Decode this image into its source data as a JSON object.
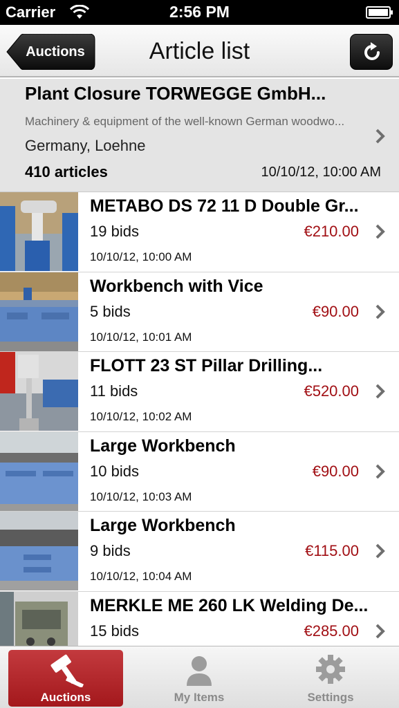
{
  "status_bar": {
    "carrier": "Carrier",
    "time": "2:56 PM"
  },
  "nav": {
    "back_label": "Auctions",
    "title": "Article list"
  },
  "auction": {
    "title": "Plant Closure TORWEGGE GmbH...",
    "description": "Machinery & equipment of the well-known German woodwo...",
    "location": "Germany, Loehne",
    "count": "410 articles",
    "date": "10/10/12, 10:00 AM"
  },
  "articles": [
    {
      "title": "METABO DS 72 11 D Double Gr...",
      "bids": "19 bids",
      "price": "€210.00",
      "date": "10/10/12, 10:00 AM"
    },
    {
      "title": "Workbench with Vice",
      "bids": "5 bids",
      "price": "€90.00",
      "date": "10/10/12, 10:01 AM"
    },
    {
      "title": "FLOTT 23 ST Pillar Drilling...",
      "bids": "11 bids",
      "price": "€520.00",
      "date": "10/10/12, 10:02 AM"
    },
    {
      "title": "Large Workbench",
      "bids": "10 bids",
      "price": "€90.00",
      "date": "10/10/12, 10:03 AM"
    },
    {
      "title": "Large Workbench",
      "bids": "9 bids",
      "price": "€115.00",
      "date": "10/10/12, 10:04 AM"
    },
    {
      "title": "MERKLE ME 260 LK Welding De...",
      "bids": "15 bids",
      "price": "€285.00",
      "date": ""
    }
  ],
  "tabs": [
    {
      "label": "Auctions",
      "icon": "gavel-icon",
      "active": true
    },
    {
      "label": "My Items",
      "icon": "person-icon",
      "active": false
    },
    {
      "label": "Settings",
      "icon": "gear-icon",
      "active": false
    }
  ],
  "colors": {
    "price": "#a10f14",
    "active_tab": "#b3262a",
    "header_bg": "#e4e4e4"
  }
}
